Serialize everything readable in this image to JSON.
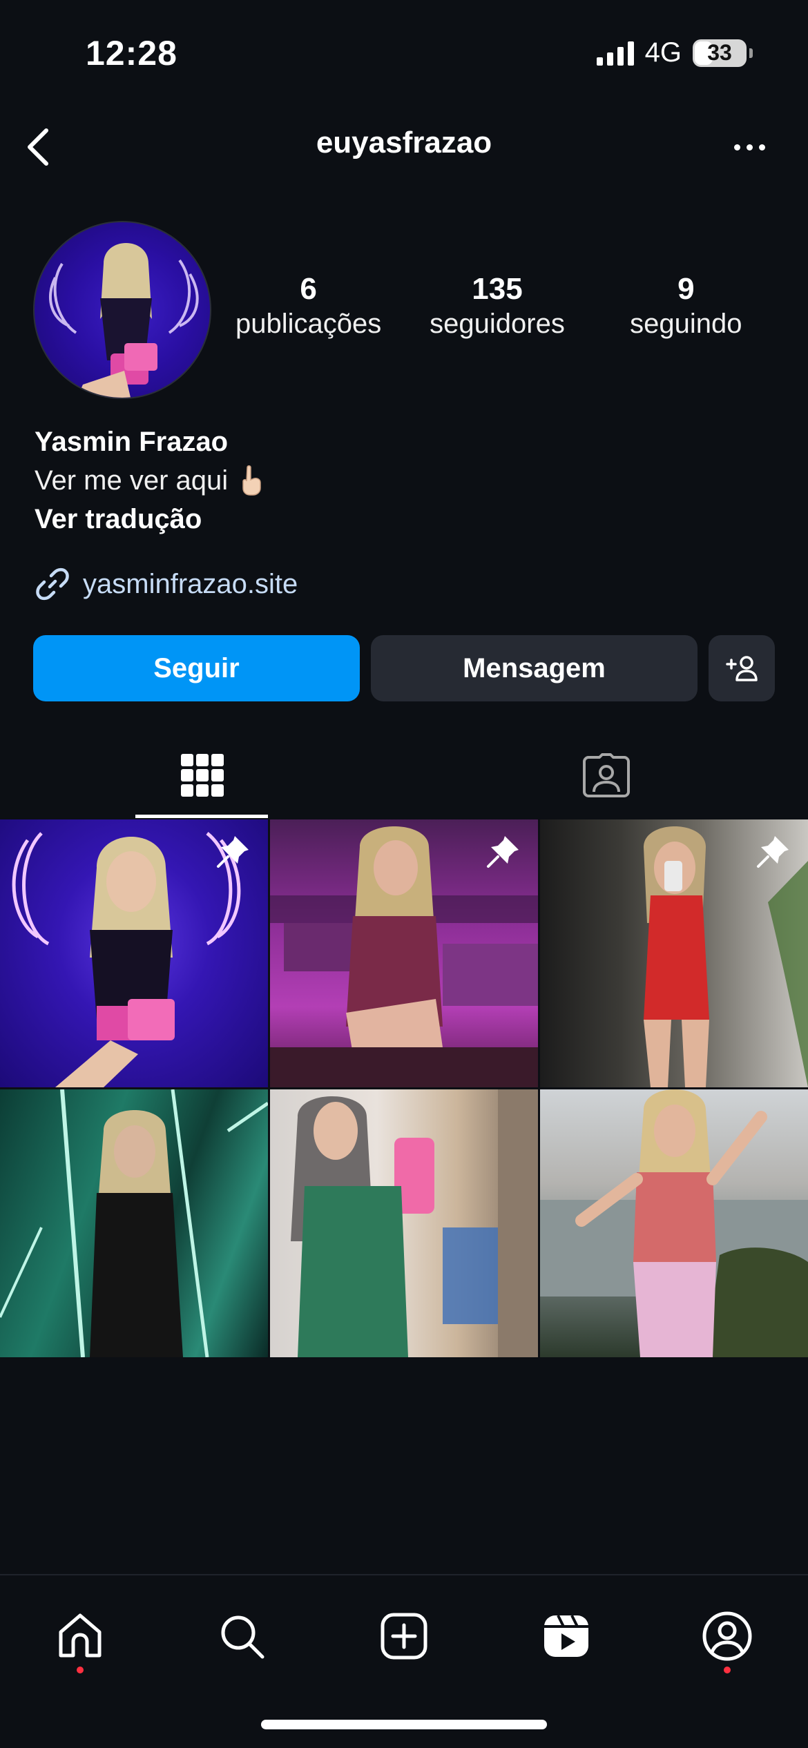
{
  "status_bar": {
    "time": "12:28",
    "network": "4G",
    "battery": "33"
  },
  "header": {
    "username": "euyasfrazao",
    "back_icon": "chevron-left-icon",
    "more_icon": "more-horizontal-icon"
  },
  "profile": {
    "stats": [
      {
        "value": "6",
        "label": "publicações"
      },
      {
        "value": "135",
        "label": "seguidores"
      },
      {
        "value": "9",
        "label": "seguindo"
      }
    ],
    "name": "Yasmin Frazao",
    "bio": "Ver me ver aqui",
    "bio_emoji": "pointing-down-hand-emoji",
    "translate": "Ver tradução",
    "link": "yasminfrazao.site"
  },
  "actions": {
    "follow": "Seguir",
    "message": "Mensagem",
    "suggest_icon": "add-person-icon"
  },
  "tabs": [
    {
      "name": "posts-grid",
      "icon": "grid-icon",
      "active": true
    },
    {
      "name": "tagged",
      "icon": "tagged-person-icon",
      "active": false
    }
  ],
  "posts": [
    {
      "pinned": true
    },
    {
      "pinned": true
    },
    {
      "pinned": true
    },
    {
      "pinned": false
    },
    {
      "pinned": false
    },
    {
      "pinned": false
    }
  ],
  "bottom_nav": [
    {
      "name": "home",
      "icon": "home-icon",
      "notification": true
    },
    {
      "name": "search",
      "icon": "search-icon",
      "notification": false
    },
    {
      "name": "create",
      "icon": "plus-square-icon",
      "notification": false
    },
    {
      "name": "reels",
      "icon": "reels-icon",
      "notification": false
    },
    {
      "name": "profile",
      "icon": "profile-icon",
      "notification": true
    }
  ],
  "colors": {
    "background": "#0c0f14",
    "follow_button": "#0095f6",
    "secondary_button": "#262a33",
    "link": "#c7dcf6",
    "notification_dot": "#ff3040"
  }
}
